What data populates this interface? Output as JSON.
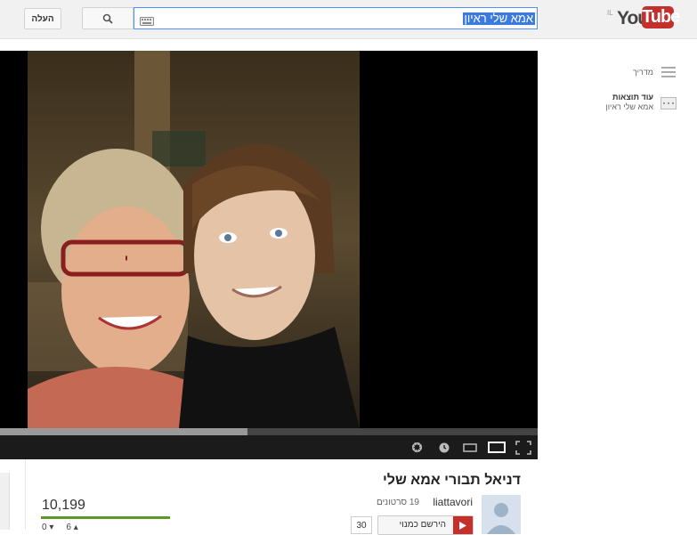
{
  "masthead": {
    "upload_label": "העלה",
    "search_query": "אמא שלי ראיון",
    "logo_region": "IL",
    "logo_you": "You",
    "logo_tube": "Tube"
  },
  "sidebar": {
    "guide_label": "מדריך",
    "more_results_title": "עוד תוצאות",
    "more_results_query": "אמא שלי ראיון"
  },
  "player": {
    "progress": 0.46
  },
  "video": {
    "title": "דניאל תבורי אמא שלי",
    "channel": "liattavori",
    "video_count": "19 סרטונים",
    "subscribe_label": "הירשם כמנוי",
    "subscriber_count": "30",
    "views": "10,199",
    "views_bar_fraction": 1.0,
    "likes": "6",
    "dislikes": "0"
  },
  "colors": {
    "accent_red": "#c4302b",
    "focus_blue": "#4d90fe",
    "views_green": "#5b9a24"
  }
}
